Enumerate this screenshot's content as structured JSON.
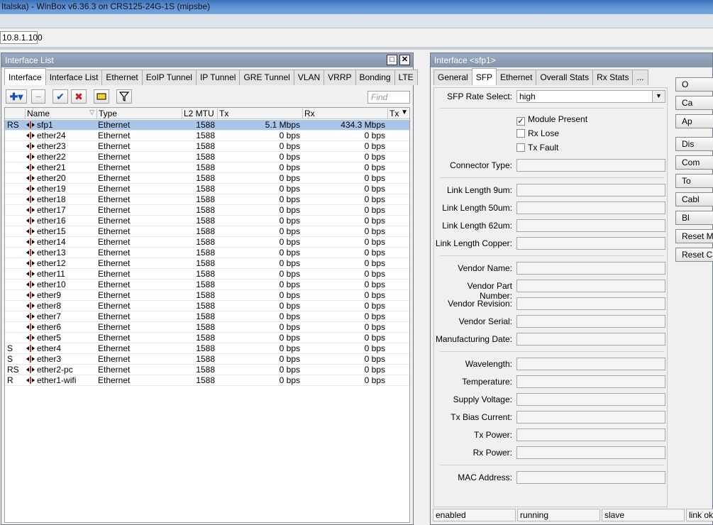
{
  "app": {
    "title": "Italska) - WinBox v6.36.3 on CRS125-24G-1S (mipsbe)",
    "address": "10.8.1.100"
  },
  "interface_list": {
    "title": "Interface List",
    "tabs": [
      "Interface",
      "Interface List",
      "Ethernet",
      "EoIP Tunnel",
      "IP Tunnel",
      "GRE Tunnel",
      "VLAN",
      "VRRP",
      "Bonding",
      "LTE"
    ],
    "find_placeholder": "Find",
    "columns": {
      "name": "Name",
      "type": "Type",
      "l2mtu": "L2 MTU",
      "tx": "Tx",
      "rx": "Rx",
      "tx2": "Tx"
    },
    "rows": [
      {
        "flag": "RS",
        "name": "sfp1",
        "type": "Ethernet",
        "mtu": "1588",
        "tx": "5.1 Mbps",
        "rx": "434.3 Mbps"
      },
      {
        "flag": "",
        "name": "ether24",
        "type": "Ethernet",
        "mtu": "1588",
        "tx": "0 bps",
        "rx": "0 bps"
      },
      {
        "flag": "",
        "name": "ether23",
        "type": "Ethernet",
        "mtu": "1588",
        "tx": "0 bps",
        "rx": "0 bps"
      },
      {
        "flag": "",
        "name": "ether22",
        "type": "Ethernet",
        "mtu": "1588",
        "tx": "0 bps",
        "rx": "0 bps"
      },
      {
        "flag": "",
        "name": "ether21",
        "type": "Ethernet",
        "mtu": "1588",
        "tx": "0 bps",
        "rx": "0 bps"
      },
      {
        "flag": "",
        "name": "ether20",
        "type": "Ethernet",
        "mtu": "1588",
        "tx": "0 bps",
        "rx": "0 bps"
      },
      {
        "flag": "",
        "name": "ether19",
        "type": "Ethernet",
        "mtu": "1588",
        "tx": "0 bps",
        "rx": "0 bps"
      },
      {
        "flag": "",
        "name": "ether18",
        "type": "Ethernet",
        "mtu": "1588",
        "tx": "0 bps",
        "rx": "0 bps"
      },
      {
        "flag": "",
        "name": "ether17",
        "type": "Ethernet",
        "mtu": "1588",
        "tx": "0 bps",
        "rx": "0 bps"
      },
      {
        "flag": "",
        "name": "ether16",
        "type": "Ethernet",
        "mtu": "1588",
        "tx": "0 bps",
        "rx": "0 bps"
      },
      {
        "flag": "",
        "name": "ether15",
        "type": "Ethernet",
        "mtu": "1588",
        "tx": "0 bps",
        "rx": "0 bps"
      },
      {
        "flag": "",
        "name": "ether14",
        "type": "Ethernet",
        "mtu": "1588",
        "tx": "0 bps",
        "rx": "0 bps"
      },
      {
        "flag": "",
        "name": "ether13",
        "type": "Ethernet",
        "mtu": "1588",
        "tx": "0 bps",
        "rx": "0 bps"
      },
      {
        "flag": "",
        "name": "ether12",
        "type": "Ethernet",
        "mtu": "1588",
        "tx": "0 bps",
        "rx": "0 bps"
      },
      {
        "flag": "",
        "name": "ether11",
        "type": "Ethernet",
        "mtu": "1588",
        "tx": "0 bps",
        "rx": "0 bps"
      },
      {
        "flag": "",
        "name": "ether10",
        "type": "Ethernet",
        "mtu": "1588",
        "tx": "0 bps",
        "rx": "0 bps"
      },
      {
        "flag": "",
        "name": "ether9",
        "type": "Ethernet",
        "mtu": "1588",
        "tx": "0 bps",
        "rx": "0 bps"
      },
      {
        "flag": "",
        "name": "ether8",
        "type": "Ethernet",
        "mtu": "1588",
        "tx": "0 bps",
        "rx": "0 bps"
      },
      {
        "flag": "",
        "name": "ether7",
        "type": "Ethernet",
        "mtu": "1588",
        "tx": "0 bps",
        "rx": "0 bps"
      },
      {
        "flag": "",
        "name": "ether6",
        "type": "Ethernet",
        "mtu": "1588",
        "tx": "0 bps",
        "rx": "0 bps"
      },
      {
        "flag": "",
        "name": "ether5",
        "type": "Ethernet",
        "mtu": "1588",
        "tx": "0 bps",
        "rx": "0 bps"
      },
      {
        "flag": "S",
        "name": "ether4",
        "type": "Ethernet",
        "mtu": "1588",
        "tx": "0 bps",
        "rx": "0 bps"
      },
      {
        "flag": "S",
        "name": "ether3",
        "type": "Ethernet",
        "mtu": "1588",
        "tx": "0 bps",
        "rx": "0 bps"
      },
      {
        "flag": "RS",
        "name": "ether2-pc",
        "type": "Ethernet",
        "mtu": "1588",
        "tx": "0 bps",
        "rx": "0 bps"
      },
      {
        "flag": "R",
        "name": "ether1-wifi",
        "type": "Ethernet",
        "mtu": "1588",
        "tx": "0 bps",
        "rx": "0 bps"
      }
    ]
  },
  "interface_detail": {
    "title": "Interface <sfp1>",
    "tabs": [
      "General",
      "SFP",
      "Ethernet",
      "Overall Stats",
      "Rx Stats",
      "..."
    ],
    "sfp_rate_label": "SFP Rate Select:",
    "sfp_rate_value": "high",
    "checkboxes": [
      {
        "label": "Module Present",
        "checked": true
      },
      {
        "label": "Rx Lose",
        "checked": false
      },
      {
        "label": "Tx Fault",
        "checked": false
      }
    ],
    "fields": {
      "connector_type": "Connector Type:",
      "link_9um": "Link Length 9um:",
      "link_50um": "Link Length 50um:",
      "link_62um": "Link Length 62um:",
      "link_copper": "Link Length Copper:",
      "vendor_name": "Vendor Name:",
      "vendor_part": "Vendor Part Number:",
      "vendor_rev": "Vendor Revision:",
      "vendor_serial": "Vendor Serial:",
      "mfg_date": "Manufacturing Date:",
      "wavelength": "Wavelength:",
      "temperature": "Temperature:",
      "supply_voltage": "Supply Voltage:",
      "tx_bias": "Tx Bias Current:",
      "tx_power": "Tx Power:",
      "rx_power": "Rx Power:",
      "mac": "MAC Address:"
    },
    "side_buttons": [
      "O",
      "Ca",
      "Ap",
      "Dis",
      "Com",
      "To",
      "Cabl",
      "Bl",
      "Reset MA",
      "Reset C"
    ],
    "status": [
      "enabled",
      "running",
      "slave",
      "link ok"
    ]
  }
}
